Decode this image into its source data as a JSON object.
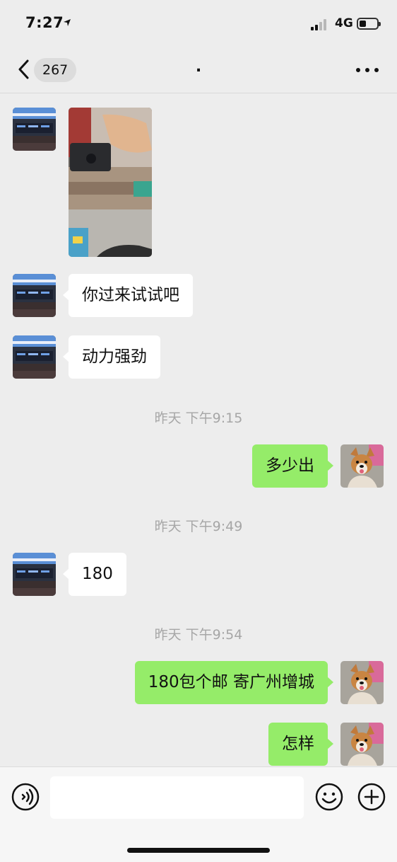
{
  "status_bar": {
    "time": "7:27",
    "network": "4G"
  },
  "nav": {
    "unread_count": "267",
    "title": "."
  },
  "messages": [
    {
      "side": "in",
      "type": "image",
      "icon": "contact-avatar-stage"
    },
    {
      "side": "in",
      "type": "text",
      "text": "你过来试试吧"
    },
    {
      "side": "in",
      "type": "text",
      "text": "动力强劲"
    },
    {
      "type": "timestamp",
      "text": "昨天 下午9:15"
    },
    {
      "side": "out",
      "type": "text",
      "text": "多少出"
    },
    {
      "type": "timestamp",
      "text": "昨天 下午9:49"
    },
    {
      "side": "in",
      "type": "text",
      "text": "180"
    },
    {
      "type": "timestamp",
      "text": "昨天 下午9:54"
    },
    {
      "side": "out",
      "type": "text",
      "text": "180包个邮 寄广州增城"
    },
    {
      "side": "out",
      "type": "text",
      "text": "怎样"
    }
  ],
  "input_bar": {
    "placeholder": ""
  },
  "colors": {
    "background": "#ededed",
    "outgoing_bubble": "#95ec69",
    "incoming_bubble": "#ffffff"
  }
}
